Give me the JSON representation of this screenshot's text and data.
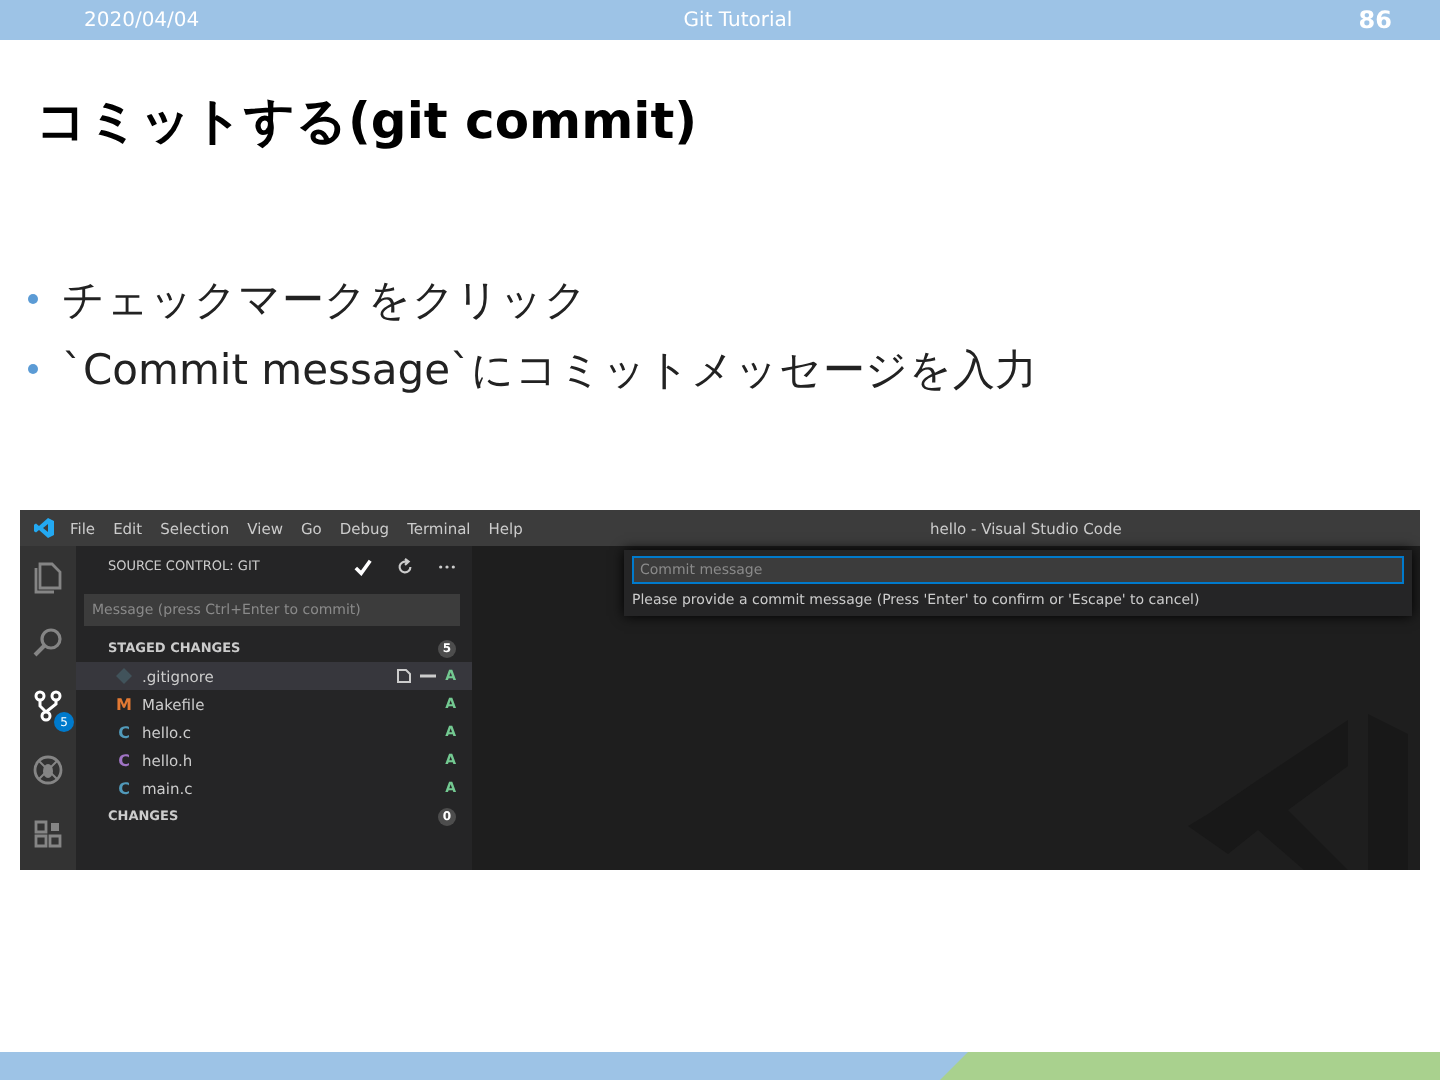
{
  "header": {
    "date": "2020/04/04",
    "title": "Git Tutorial",
    "page": "86"
  },
  "slide_title": "コミットする(git commit)",
  "bullets": [
    "チェックマークをクリック",
    "`Commit message`にコミットメッセージを入力"
  ],
  "vscode": {
    "menu": [
      "File",
      "Edit",
      "Selection",
      "View",
      "Go",
      "Debug",
      "Terminal",
      "Help"
    ],
    "window_title": "hello - Visual Studio Code",
    "activity": [
      {
        "kind": "files",
        "selected": false
      },
      {
        "kind": "search",
        "selected": false
      },
      {
        "kind": "scm",
        "selected": true,
        "badge": "5"
      },
      {
        "kind": "debug",
        "selected": false
      },
      {
        "kind": "extensions",
        "selected": false
      }
    ],
    "sidebar": {
      "title": "SOURCE CONTROL: GIT",
      "placeholder": "Message (press Ctrl+Enter to commit)",
      "groups": [
        {
          "label": "STAGED CHANGES",
          "count": "5",
          "files": [
            {
              "kind": "diamond",
              "name": ".gitignore",
              "status": "A",
              "color": "#41535b",
              "selected": true
            },
            {
              "kind": "letter",
              "icon": "M",
              "name": "Makefile",
              "status": "A",
              "color": "#e37933",
              "selected": false
            },
            {
              "kind": "letter",
              "icon": "C",
              "name": "hello.c",
              "status": "A",
              "color": "#519aba",
              "selected": false
            },
            {
              "kind": "letter",
              "icon": "C",
              "name": "hello.h",
              "status": "A",
              "color": "#a074c4",
              "selected": false
            },
            {
              "kind": "letter",
              "icon": "C",
              "name": "main.c",
              "status": "A",
              "color": "#519aba",
              "selected": false
            }
          ]
        },
        {
          "label": "CHANGES",
          "count": "0"
        }
      ]
    },
    "quick_input": {
      "placeholder": "Commit message",
      "hint": "Please provide a commit message (Press 'Enter' to confirm or 'Escape' to cancel)"
    }
  }
}
